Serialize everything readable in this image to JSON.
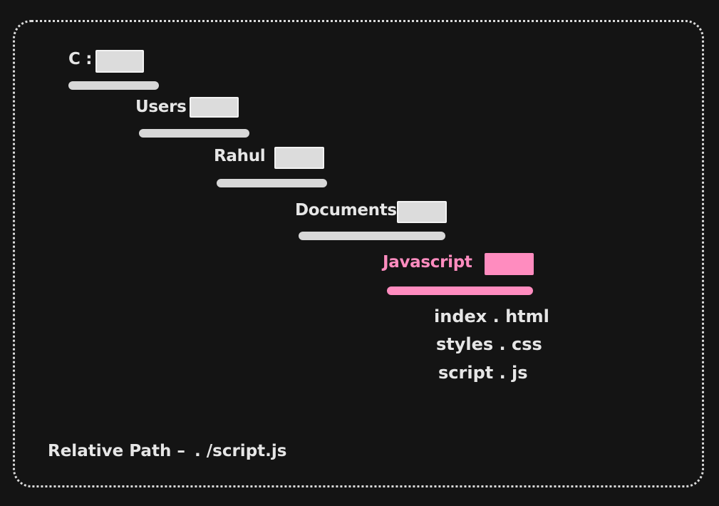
{
  "folders": [
    {
      "label": "C :"
    },
    {
      "label": "Users"
    },
    {
      "label": "Rahul"
    },
    {
      "label": "Documents"
    },
    {
      "label": "Javascript",
      "active": true
    }
  ],
  "files": [
    {
      "name": "index . html"
    },
    {
      "name": "styles . css"
    },
    {
      "name": "script . js"
    }
  ],
  "relative_path": {
    "label": "Relative Path –",
    "value": ". /script.js"
  },
  "colors": {
    "background": "#141414",
    "foreground": "#e6e6e6",
    "accent": "#ff8cbf"
  }
}
